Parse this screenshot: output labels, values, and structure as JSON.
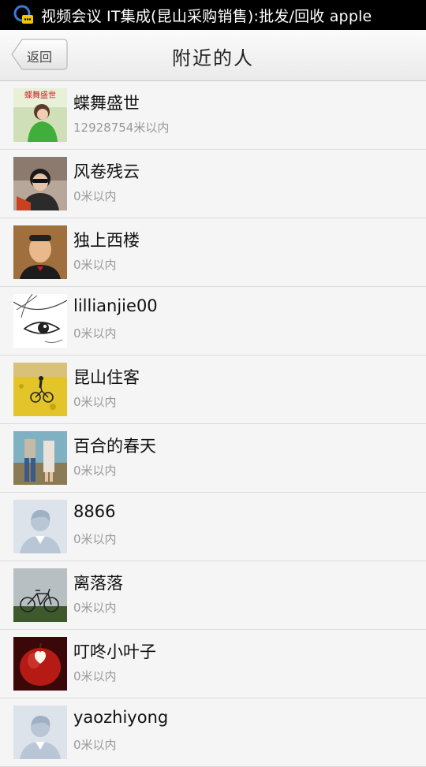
{
  "status_bar": {
    "text": "视频会议 IT集成(昆山采购销售):批发/回收  apple",
    "icon": "chat-app-icon"
  },
  "header": {
    "back_label": "返回",
    "title": "附近的人"
  },
  "people": [
    {
      "name": "蝶舞盛世",
      "distance": "12928754米以内",
      "avatar": "photo-woman-green",
      "avatar_text": "蝶舞盛世"
    },
    {
      "name": "风卷残云",
      "distance": "0米以内",
      "avatar": "photo-man-sunglasses"
    },
    {
      "name": "独上西楼",
      "distance": "0米以内",
      "avatar": "photo-man-bowtie"
    },
    {
      "name": "lillianjie00",
      "distance": "0米以内",
      "avatar": "sketch-eye"
    },
    {
      "name": "昆山住客",
      "distance": "0米以内",
      "avatar": "photo-cyclist-flowers"
    },
    {
      "name": "百合的春天",
      "distance": "0米以内",
      "avatar": "photo-couple"
    },
    {
      "name": "8866",
      "distance": "0米以内",
      "avatar": "default-avatar"
    },
    {
      "name": "离落落",
      "distance": "0米以内",
      "avatar": "photo-bicycle"
    },
    {
      "name": "叮咚小叶子",
      "distance": "0米以内",
      "avatar": "photo-apple-heart"
    },
    {
      "name": "yaozhiyong",
      "distance": "0米以内",
      "avatar": "default-avatar"
    }
  ]
}
